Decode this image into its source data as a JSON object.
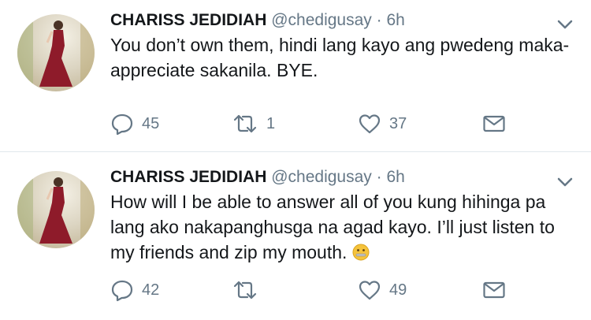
{
  "tweets": [
    {
      "name": "CHARISS JEDIDIAH",
      "handle": "@chedigusay",
      "separator": "·",
      "time": "6h",
      "text": "You don’t own them, hindi lang kayo ang pwedeng maka-appreciate sakanila. BYE.",
      "emoji": "",
      "replies": "45",
      "retweets": "1",
      "likes": "37"
    },
    {
      "name": "CHARISS JEDIDIAH",
      "handle": "@chedigusay",
      "separator": "·",
      "time": "6h",
      "text": "How will I be able to answer all of you kung hihinga pa lang ako nakapanghusga na agad kayo. I’ll just listen to my friends and zip my mouth.",
      "emoji": "zipper-mouth-face",
      "replies": "42",
      "retweets": "",
      "likes": "49"
    }
  ],
  "colors": {
    "text": "#14171a",
    "secondary": "#657786",
    "divider": "#e1e8ed",
    "dress": "#8e1b2a"
  },
  "icons": [
    "reply-icon",
    "retweet-icon",
    "like-icon",
    "direct-message-icon",
    "chevron-down-icon",
    "zipper-mouth-face-emoji"
  ]
}
